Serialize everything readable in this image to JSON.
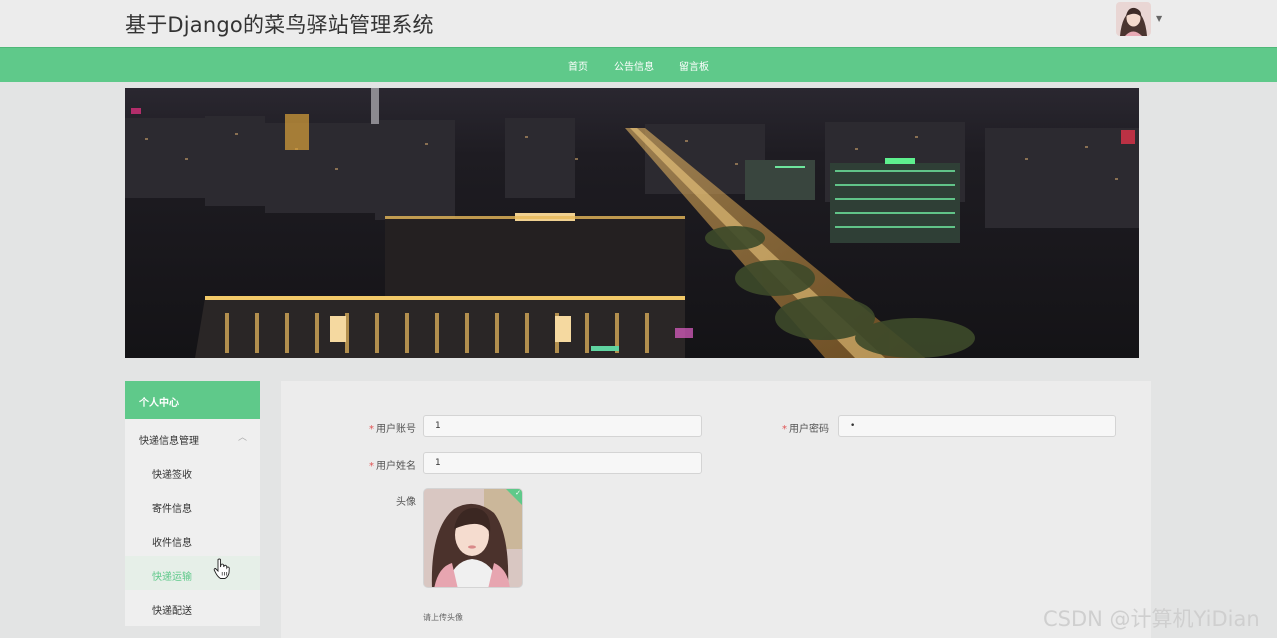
{
  "header": {
    "title": "基于Django的菜鸟驿站管理系统"
  },
  "nav": {
    "items": [
      "首页",
      "公告信息",
      "留言板"
    ]
  },
  "sidebar": {
    "header": "个人中心",
    "group": {
      "label": "快递信息管理",
      "icon": "chevron-up-icon"
    },
    "items": [
      "快递签收",
      "寄件信息",
      "收件信息",
      "快递运输",
      "快递配送"
    ],
    "active_index": 3
  },
  "form": {
    "account_label": "用户账号",
    "account_value": "1",
    "password_label": "用户密码",
    "password_value": "•",
    "name_label": "用户姓名",
    "name_value": "1",
    "avatar_label": "头像",
    "upload_tip": "请上传头像"
  },
  "watermark": "CSDN @计算机YiDian",
  "colors": {
    "accent": "#5fc98a",
    "required": "#e05353"
  }
}
